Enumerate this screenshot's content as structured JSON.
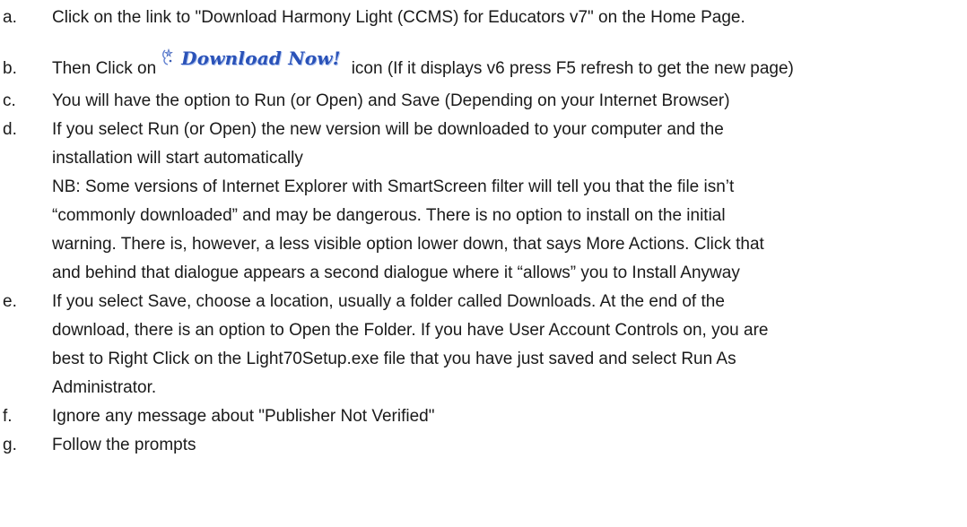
{
  "clipped_heading": "",
  "download_button": {
    "label": "Download Now!",
    "icon": "sparkle-icon",
    "color": "#2a52b8"
  },
  "steps": [
    {
      "marker": "a.",
      "lines": [
        "Click on the link to \"Download Harmony Light (CCMS) for Educators v7\" on the Home Page."
      ]
    },
    {
      "marker": "b.",
      "before": "Then Click on",
      "after": "icon (If it displays v6 press F5 refresh to get the new page)"
    },
    {
      "marker": "c.",
      "lines": [
        "You will have the option to Run (or Open) and Save (Depending on your Internet Browser)"
      ]
    },
    {
      "marker": "d.",
      "lines": [
        "If you select Run (or Open) the new version will be downloaded to your computer and the",
        "installation will start automatically",
        "NB: Some versions of Internet Explorer with SmartScreen filter will tell you that the file isn’t",
        "“commonly downloaded” and may be dangerous. There is no option to install on the initial",
        "warning. There is, however, a less visible option lower down, that says More Actions. Click that",
        "and behind that dialogue appears a second dialogue where it “allows” you to Install Anyway"
      ]
    },
    {
      "marker": "e.",
      "lines": [
        "If you select Save, choose a location, usually a folder called Downloads. At the end of the",
        "download, there is an option to Open the Folder. If you have User Account Controls on, you are",
        "best to Right  Click on the Light70Setup.exe file that you have just saved and select Run As",
        "Administrator."
      ]
    },
    {
      "marker": "f.",
      "lines": [
        "Ignore any message about \"Publisher Not Verified\""
      ]
    },
    {
      "marker": "g.",
      "lines": [
        "Follow the prompts"
      ]
    }
  ]
}
